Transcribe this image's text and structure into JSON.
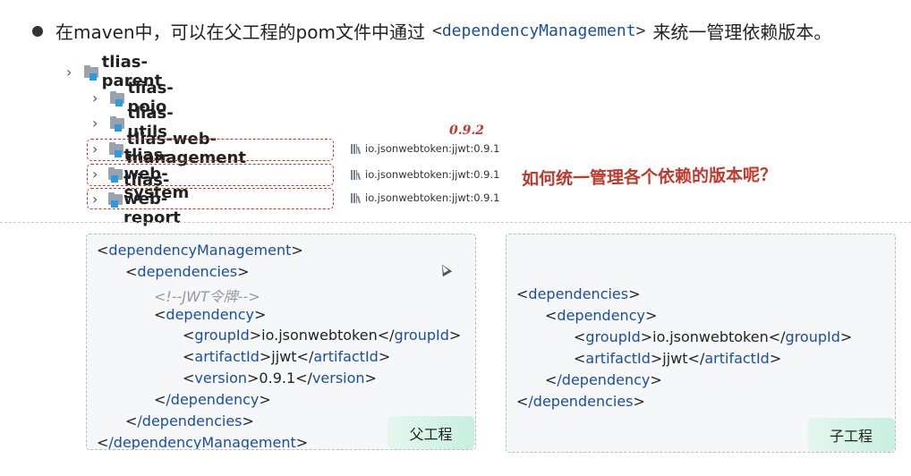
{
  "header": {
    "text_before": "在maven中，可以在父工程的pom文件中通过",
    "tag_open": "<",
    "tag_name": "dependencyManagement",
    "tag_close": ">",
    "text_after": "来统一管理依赖版本。"
  },
  "tree": {
    "root": "tlias-parent",
    "modules": [
      "tlias-pojo",
      "tlias-utils",
      "tlias-web-management",
      "tlias-web-system",
      "tlias-web-report"
    ],
    "dependencies": [
      "io.jsonwebtoken:jjwt:0.9.1",
      "io.jsonwebtoken:jjwt:0.9.1",
      "io.jsonwebtoken:jjwt:0.9.1"
    ]
  },
  "annotations": {
    "version_note": "0.9.2",
    "question": "如何统一管理各个依赖的版本呢？"
  },
  "parent_panel": {
    "label": "父工程",
    "lines": {
      "l1_open": "<",
      "l1_tag": "dependencyManagement",
      "l1_close": ">",
      "l2_open": "<",
      "l2_tag": "dependencies",
      "l2_close": ">",
      "l3_comment": "<!--JWT令牌-->",
      "l4_open": "<",
      "l4_tag": "dependency",
      "l4_close": ">",
      "l5_tag": "groupId",
      "l5_value": "io.jsonwebtoken",
      "l6_tag": "artifactId",
      "l6_value": "jjwt",
      "l7_tag": "version",
      "l7_value": "0.9.1",
      "l8_tag": "/dependency",
      "l9_tag": "/dependencies",
      "l10_tag": "/dependencyManagement"
    }
  },
  "child_panel": {
    "label": "子工程",
    "lines": {
      "l1_tag": "dependencies",
      "l2_tag": "dependency",
      "l3_tag": "groupId",
      "l3_value": "io.jsonwebtoken",
      "l4_tag": "artifactId",
      "l4_value": "jjwt",
      "l5_tag": "/dependency",
      "l6_tag": "/dependencies"
    }
  },
  "colors": {
    "tag": "#1a4fa0",
    "annotation": "#c0392b",
    "chip": "#d4f2e5"
  }
}
